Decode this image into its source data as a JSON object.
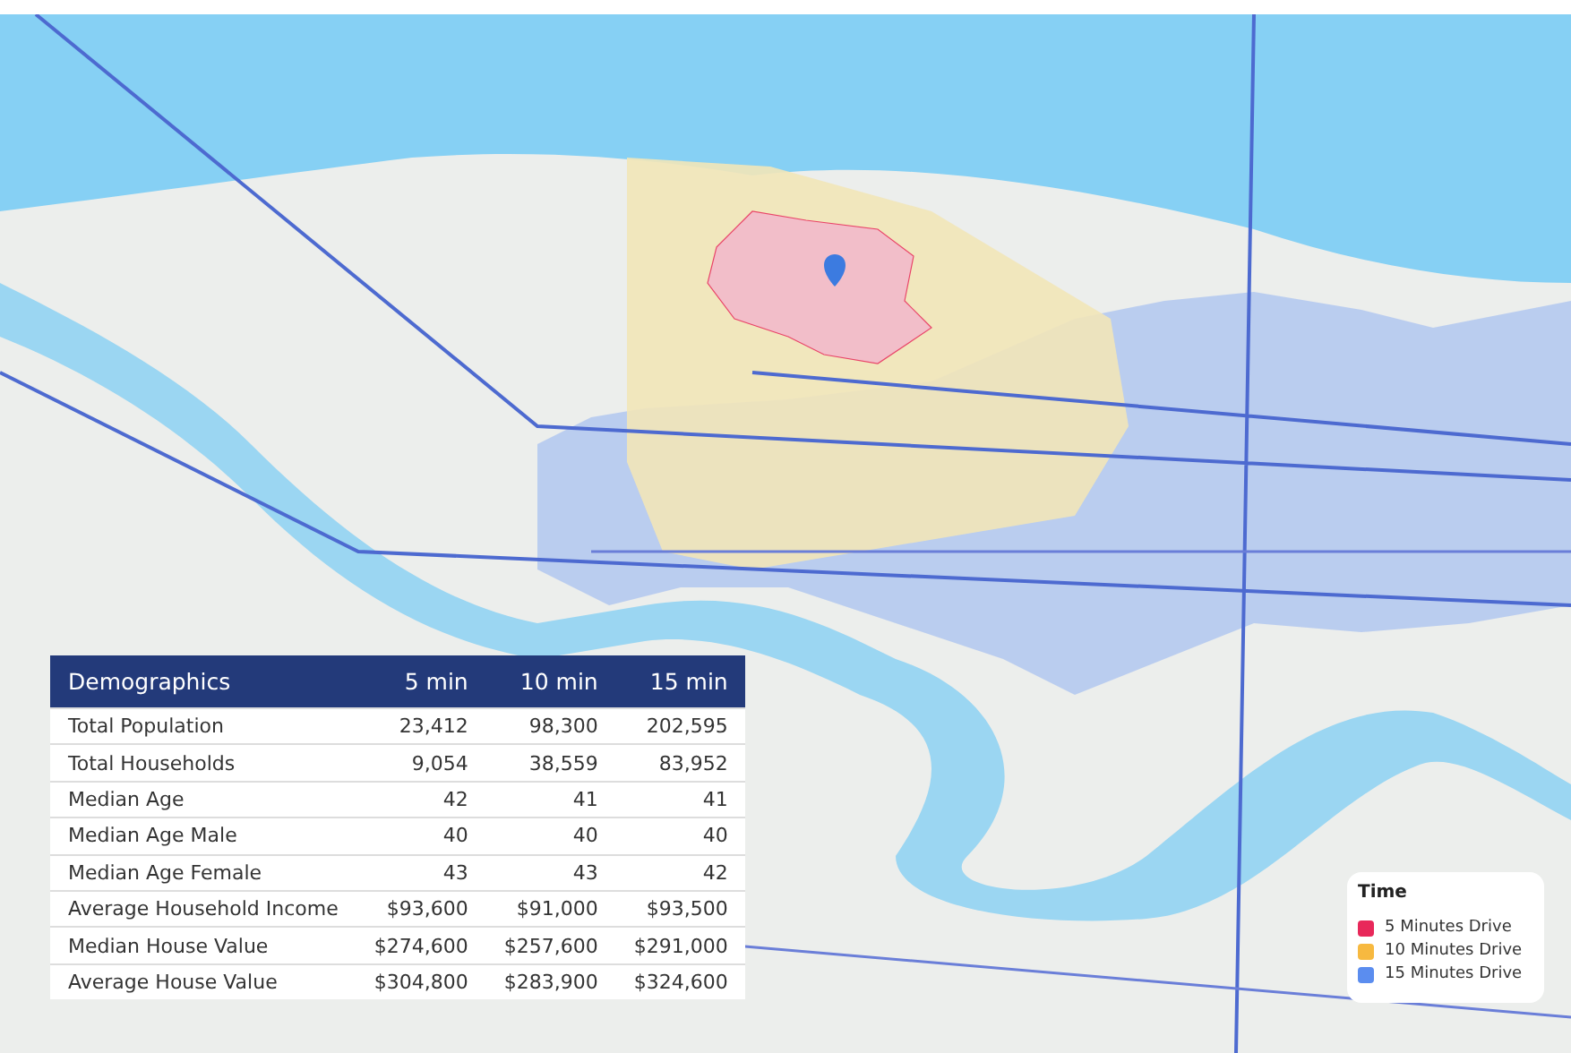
{
  "table": {
    "columns": [
      "Demographics",
      "5 min",
      "10 min",
      "15 min"
    ],
    "rows": [
      {
        "label": "Total Population",
        "values": [
          "23,412",
          "98,300",
          "202,595"
        ]
      },
      {
        "label": "Total Households",
        "values": [
          "9,054",
          "38,559",
          "83,952"
        ]
      },
      {
        "label": "Median Age",
        "values": [
          "42",
          "41",
          "41"
        ]
      },
      {
        "label": "Median Age Male",
        "values": [
          "40",
          "40",
          "40"
        ]
      },
      {
        "label": "Median Age Female",
        "values": [
          "43",
          "43",
          "42"
        ]
      },
      {
        "label": "Average Household Income",
        "values": [
          "$93,600",
          "$91,000",
          "$93,500"
        ]
      },
      {
        "label": "Median House Value",
        "values": [
          "$274,600",
          "$257,600",
          "$291,000"
        ]
      },
      {
        "label": "Average House Value",
        "values": [
          "$304,800",
          "$283,900",
          "$324,600"
        ]
      }
    ]
  },
  "legend": {
    "title": "Time",
    "items": [
      {
        "label": "5 Minutes Drive",
        "color": "#e8285a"
      },
      {
        "label": "10 Minutes Drive",
        "color": "#f7b940"
      },
      {
        "label": "15 Minutes Drive",
        "color": "#5b8def"
      }
    ]
  }
}
